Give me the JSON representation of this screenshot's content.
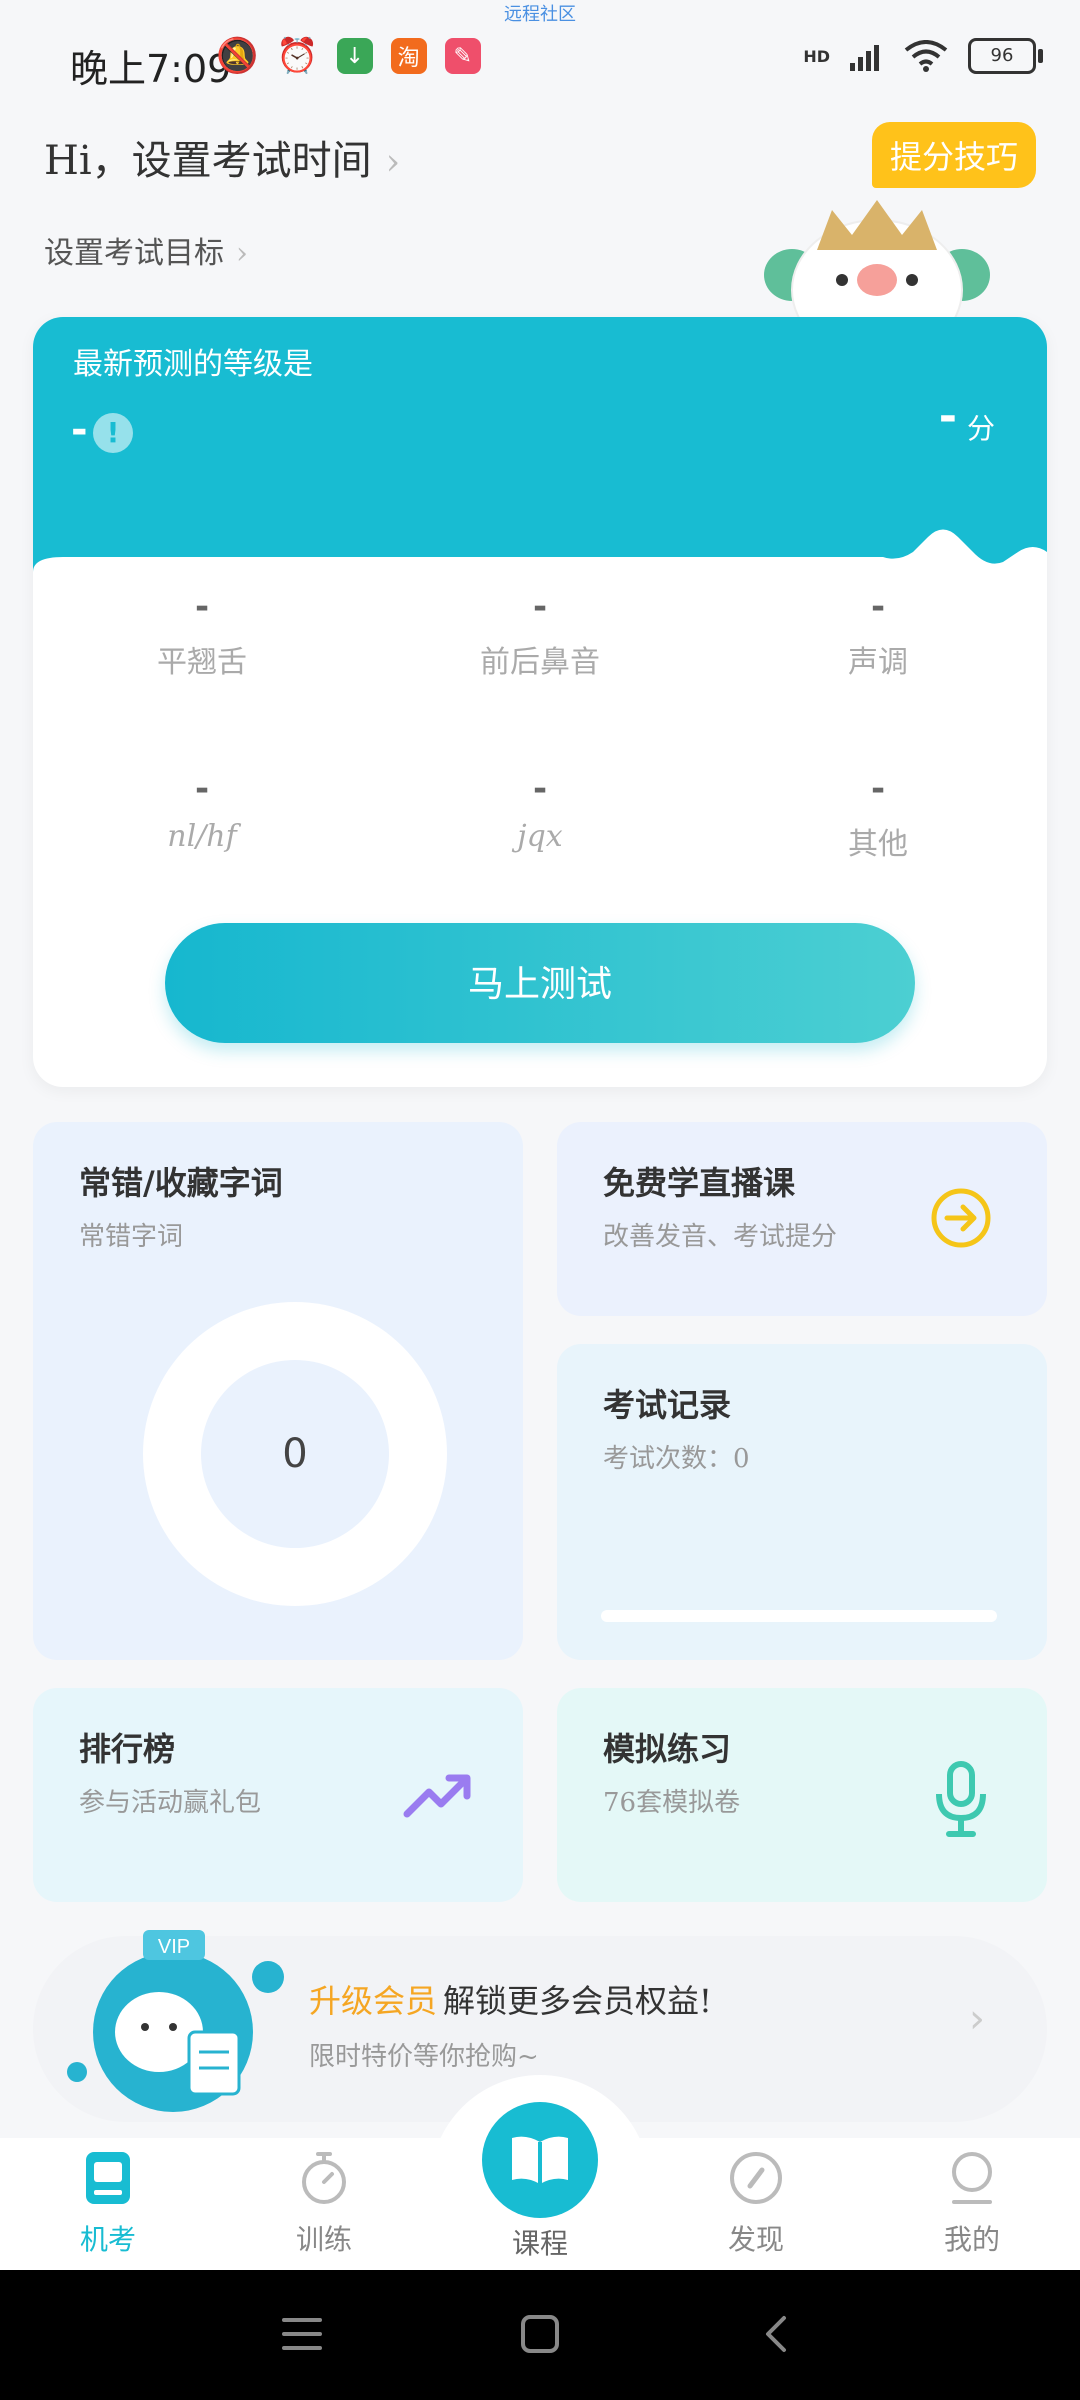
{
  "status_bar": {
    "watermark": "远程社区",
    "time": "晚上7:09",
    "network": "HD",
    "battery": "96"
  },
  "header": {
    "greeting": "Hi，设置考试时间",
    "target": "设置考试目标",
    "tips_button": "提分技巧"
  },
  "prediction": {
    "title": "最新预测的等级是",
    "level": "-",
    "score": "-",
    "unit": "分",
    "metrics": [
      {
        "value": "-",
        "label": "平翘舌"
      },
      {
        "value": "-",
        "label": "前后鼻音"
      },
      {
        "value": "-",
        "label": "声调"
      },
      {
        "value": "-",
        "label": "nl/hf"
      },
      {
        "value": "-",
        "label": "jqx"
      },
      {
        "value": "-",
        "label": "其他"
      }
    ],
    "test_button": "马上测试"
  },
  "tiles": {
    "wrong": {
      "title": "常错/收藏字词",
      "subtitle": "常错字词",
      "count": "0"
    },
    "live": {
      "title": "免费学直播课",
      "subtitle": "改善发音、考试提分"
    },
    "record": {
      "title": "考试记录",
      "subtitle": "考试次数：0"
    },
    "rank": {
      "title": "排行榜",
      "subtitle": "参与活动赢礼包"
    },
    "mock": {
      "title": "模拟练习",
      "subtitle": "76套模拟卷"
    }
  },
  "vip": {
    "badge": "VIP",
    "title_highlight": "升级会员",
    "title_rest": "解锁更多会员权益!",
    "subtitle": "限时特价等你抢购~"
  },
  "nav": {
    "items": [
      {
        "label": "机考"
      },
      {
        "label": "训练"
      },
      {
        "label": "课程"
      },
      {
        "label": "发现"
      },
      {
        "label": "我的"
      }
    ]
  },
  "colors": {
    "primary": "#18bcd2",
    "tips": "#ffc21a",
    "vip_accent": "#f5a623",
    "rank_icon": "#9a7cf0",
    "mic_icon": "#3ec9b0"
  }
}
